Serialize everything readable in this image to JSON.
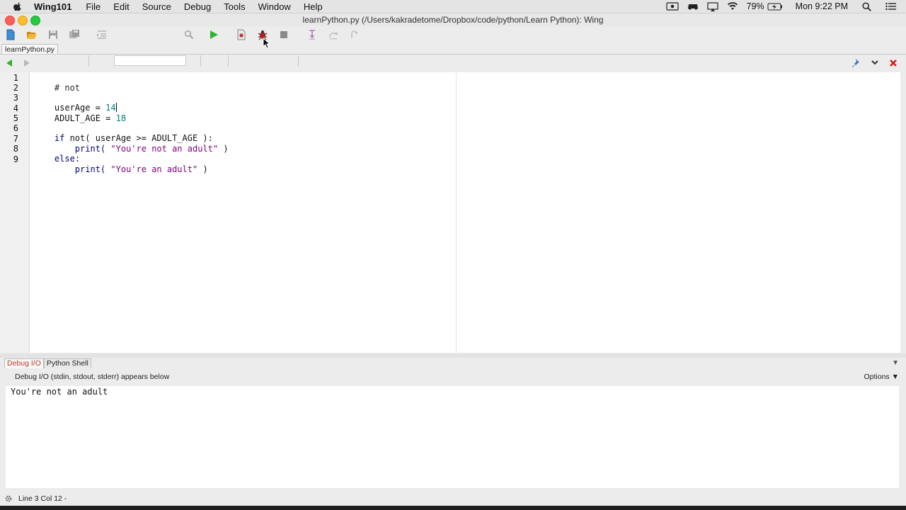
{
  "menubar": {
    "app_name": "Wing101",
    "items": [
      "File",
      "Edit",
      "Source",
      "Debug",
      "Tools",
      "Window",
      "Help"
    ],
    "battery": "79%",
    "clock": "Mon 9:22 PM"
  },
  "window": {
    "title": "learnPython.py (/Users/kakradetome/Dropbox/code/python/Learn Python): Wing"
  },
  "editor": {
    "tab_label": "learnPython.py",
    "line_numbers": [
      "1",
      "2",
      "3",
      "4",
      "5",
      "6",
      "7",
      "8",
      "9"
    ],
    "code": {
      "l1": "# not",
      "l3_var": "userAge = ",
      "l3_val": "14",
      "l4_var": "ADULT_AGE = ",
      "l4_val": "18",
      "l6_kw": "if",
      "l6_rest": " not( userAge >= ADULT_AGE ):",
      "l7_fn": "    print( ",
      "l7_str": "\"You're not an adult\"",
      "l7_end": " )",
      "l8_kw": "else",
      "l8_rest": ":",
      "l9_fn": "    print( ",
      "l9_str": "\"You're an adult\"",
      "l9_end": " )"
    }
  },
  "panel": {
    "tabs": [
      "Debug I/O",
      "Python Shell"
    ],
    "caption": "Debug I/O (stdin, stdout, stderr) appears below",
    "options_label": "Options ▼",
    "dropdown": "▼",
    "output": "You're not an adult"
  },
  "status": {
    "text": "Line 3 Col 12 -"
  },
  "colors": {
    "active_tab": "#c0392b",
    "run_green": "#2fb52f",
    "close_red": "#d21a1a"
  }
}
